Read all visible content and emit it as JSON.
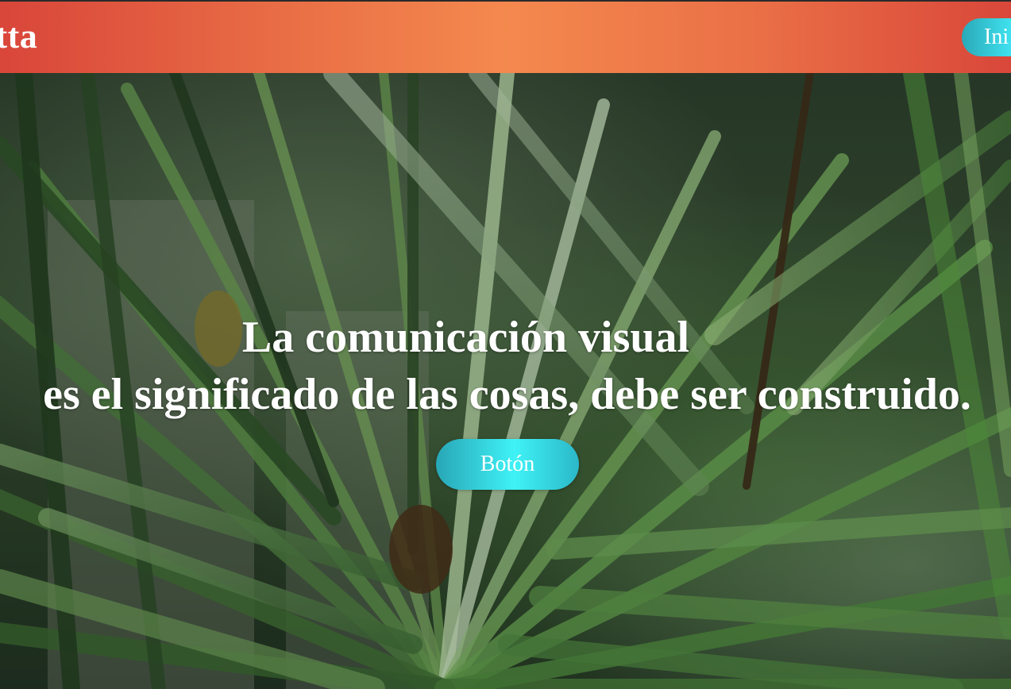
{
  "header": {
    "brand": "otta",
    "nav_button_label": "Ini"
  },
  "hero": {
    "line_1": "La comunicación visual",
    "line_2": "es el significado de las cosas, debe ser construido.",
    "button_label": "Botón"
  },
  "colors": {
    "header_gradient_edge": "#d9463a",
    "header_gradient_center": "#f4894e",
    "button_gradient_edge": "#28a6b6",
    "button_gradient_center": "#3ff2f6",
    "text": "#ffffff"
  }
}
